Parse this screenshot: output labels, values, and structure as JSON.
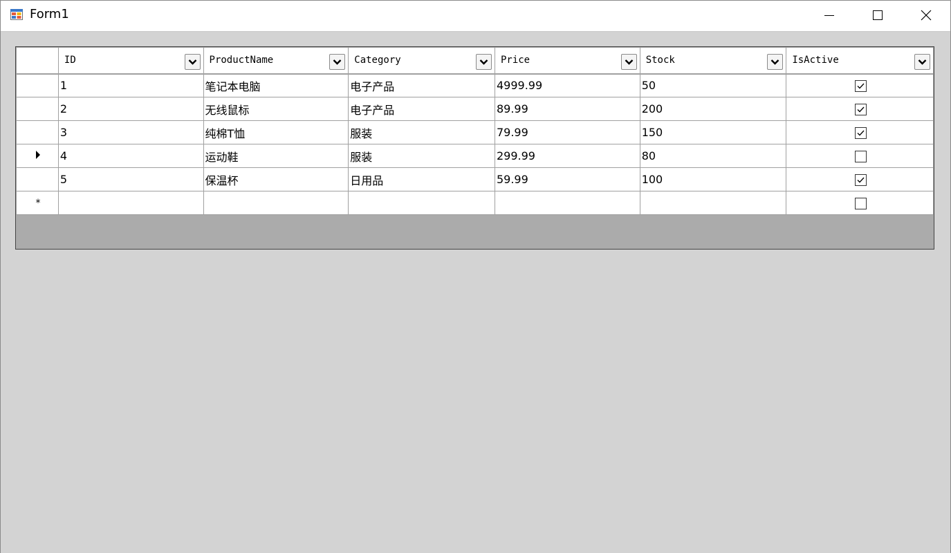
{
  "window": {
    "title": "Form1"
  },
  "grid": {
    "columns": [
      "ID",
      "ProductName",
      "Category",
      "Price",
      "Stock",
      "IsActive"
    ],
    "rows": [
      {
        "id": "1",
        "name": "笔记本电脑",
        "category": "电子产品",
        "price": "4999.99",
        "stock": "50",
        "active": true
      },
      {
        "id": "2",
        "name": "无线鼠标",
        "category": "电子产品",
        "price": "89.99",
        "stock": "200",
        "active": true
      },
      {
        "id": "3",
        "name": "纯棉T恤",
        "category": "服装",
        "price": "79.99",
        "stock": "150",
        "active": true
      },
      {
        "id": "4",
        "name": "运动鞋",
        "category": "服装",
        "price": "299.99",
        "stock": "80",
        "active": false
      },
      {
        "id": "5",
        "name": "保温杯",
        "category": "日用品",
        "price": "59.99",
        "stock": "100",
        "active": true
      }
    ],
    "current_row_index": 3,
    "selected_cell": {
      "row": 3,
      "column": "Stock"
    },
    "new_row_marker": "*",
    "current_row_marker": "▶"
  },
  "colors": {
    "selection": "#0078d7",
    "client_bg": "#d3d3d3",
    "grid_bg": "#ababab"
  },
  "icons": {
    "app": "winforms-app-icon",
    "filter": "chevron-down-icon",
    "check": "check-icon"
  }
}
